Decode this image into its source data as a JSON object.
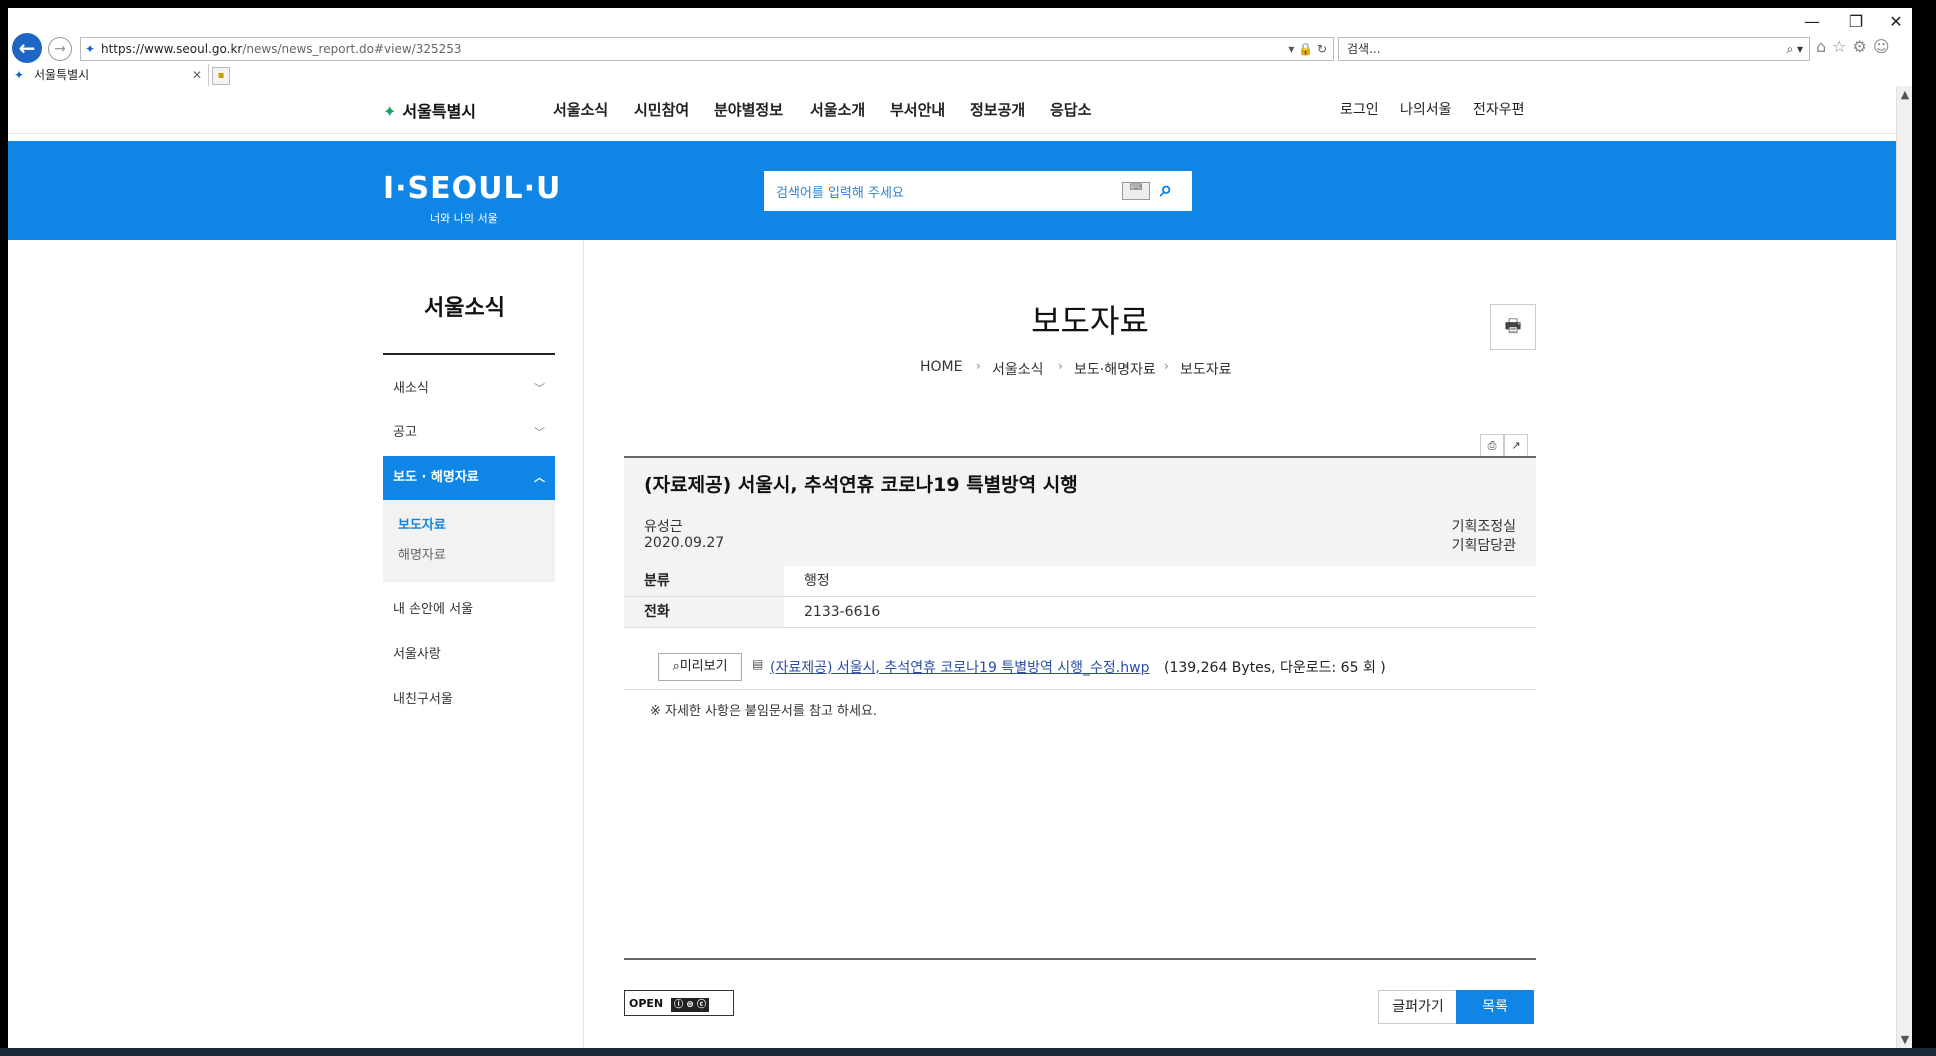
{
  "browser": {
    "url_host": "https://www.seoul.go.kr",
    "url_path": "/news/news_report.do#view/325253",
    "search_placeholder": "검색...",
    "tab_title": "서울특별시",
    "window_controls": [
      "—",
      "❐",
      "✕"
    ]
  },
  "gnb": {
    "logo": "서울특별시",
    "menu": [
      "서울소식",
      "시민참여",
      "분야별정보",
      "서울소개",
      "부서안내",
      "정보공개",
      "응답소"
    ],
    "util": [
      "로그인",
      "나의서울",
      "전자우편"
    ]
  },
  "banner": {
    "brand": "I·SEOUL·U",
    "brand_sub": "너와 나의 서울",
    "search_placeholder": "검색어를 입력해 주세요"
  },
  "sidebar": {
    "title": "서울소식",
    "items": [
      "새소식",
      "공고",
      "보도 · 해명자료",
      "내 손안에 서울",
      "서울사랑",
      "내친구서울"
    ],
    "sub_items": [
      "보도자료",
      "해명자료"
    ]
  },
  "content": {
    "page_title": "보도자료",
    "breadcrumb": [
      "HOME",
      "서울소식",
      "보도·해명자료",
      "보도자료"
    ],
    "article": {
      "title": "(자료제공) 서울시, 추석연휴 코로나19 특별방역 시행",
      "writer": "유성근",
      "date": "2020.09.27",
      "dept1": "기획조정실",
      "dept2": "기획담당관"
    },
    "rows": [
      {
        "key": "분류",
        "value": "행정"
      },
      {
        "key": "전화",
        "value": "2133-6616"
      }
    ],
    "preview_label": "미리보기",
    "file_name": "(자료제공) 서울시, 추석연휴 코로나19 특별방역 시행_수정.hwp",
    "file_info": "(139,264 Bytes, 다운로드: 65 회 )",
    "note": "※ 자세한 사항은 붙임문서를 참고 하세요.",
    "open_license": "OPEN",
    "btn_scrap": "글퍼가기",
    "btn_list": "목록"
  },
  "colors": {
    "brand_blue": "#0f86e5",
    "link_blue": "#2b4ea8"
  }
}
